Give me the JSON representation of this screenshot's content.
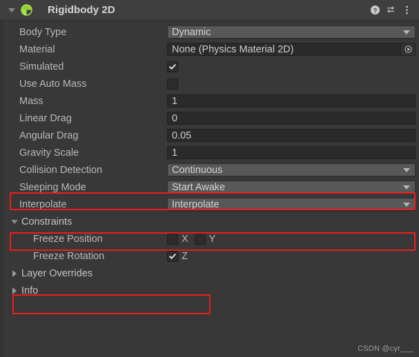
{
  "header": {
    "title": "Rigidbody 2D",
    "foldout_icon": "chevron-down-icon",
    "component_icon": "rigidbody2d-icon",
    "help_icon": "help-icon",
    "preset_icon": "preset-settings-icon",
    "menu_icon": "more-vertical-icon"
  },
  "colors": {
    "panel_bg": "#383838",
    "header_bg": "#3f3f3f",
    "popup_bg": "#585858",
    "field_bg": "#2a2a2a",
    "text": "#b9b9b9",
    "highlight": "#f01c1c",
    "icon_green": "#a6e34a"
  },
  "fields": {
    "body_type": {
      "label": "Body Type",
      "value": "Dynamic",
      "type": "popup"
    },
    "material": {
      "label": "Material",
      "value": "None (Physics Material 2D)",
      "type": "object"
    },
    "simulated": {
      "label": "Simulated",
      "value": "checked",
      "type": "toggle"
    },
    "use_auto_mass": {
      "label": "Use Auto Mass",
      "value": "unchecked",
      "type": "toggle"
    },
    "mass": {
      "label": "Mass",
      "value": "1",
      "type": "number"
    },
    "linear_drag": {
      "label": "Linear Drag",
      "value": "0",
      "type": "number"
    },
    "angular_drag": {
      "label": "Angular Drag",
      "value": "0.05",
      "type": "number"
    },
    "gravity_scale": {
      "label": "Gravity Scale",
      "value": "1",
      "type": "number"
    },
    "collision_detection": {
      "label": "Collision Detection",
      "value": "Continuous",
      "type": "popup"
    },
    "sleeping_mode": {
      "label": "Sleeping Mode",
      "value": "Start Awake",
      "type": "popup"
    },
    "interpolate": {
      "label": "Interpolate",
      "value": "Interpolate",
      "type": "popup"
    }
  },
  "constraints": {
    "label": "Constraints",
    "expanded": true,
    "freeze_position": {
      "label": "Freeze Position",
      "axes": [
        {
          "axis": "X",
          "value": "unchecked"
        },
        {
          "axis": "Y",
          "value": "unchecked"
        }
      ]
    },
    "freeze_rotation": {
      "label": "Freeze Rotation",
      "axes": [
        {
          "axis": "Z",
          "value": "checked"
        }
      ]
    }
  },
  "sections": {
    "layer_overrides": {
      "label": "Layer Overrides",
      "expanded": false
    },
    "info": {
      "label": "Info",
      "expanded": false
    }
  },
  "watermark": "CSDN @cyr___"
}
